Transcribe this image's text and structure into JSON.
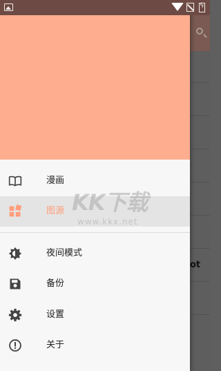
{
  "status_bar": {
    "icons": [
      "image-icon",
      "wifi-icon",
      "no-sim-icon",
      "battery-charging-icon"
    ]
  },
  "colors": {
    "header": "#ffad8f",
    "accent": "#ff9d7c",
    "status_bar": "#6d4a44"
  },
  "menu": {
    "items": [
      {
        "label": "漫画",
        "icon": "book-open-icon",
        "active": false
      },
      {
        "label": "图源",
        "icon": "grid-source-icon",
        "active": true
      },
      {
        "label": "夜间模式",
        "icon": "brightness-icon",
        "active": false
      },
      {
        "label": "备份",
        "icon": "save-icon",
        "active": false
      },
      {
        "label": "设置",
        "icon": "gear-icon",
        "active": false
      },
      {
        "label": "关于",
        "icon": "info-icon",
        "active": false
      }
    ]
  },
  "background_app": {
    "partial_text": "ot"
  },
  "watermark": {
    "logo": "KK下载",
    "url": "www.kkx.net"
  }
}
